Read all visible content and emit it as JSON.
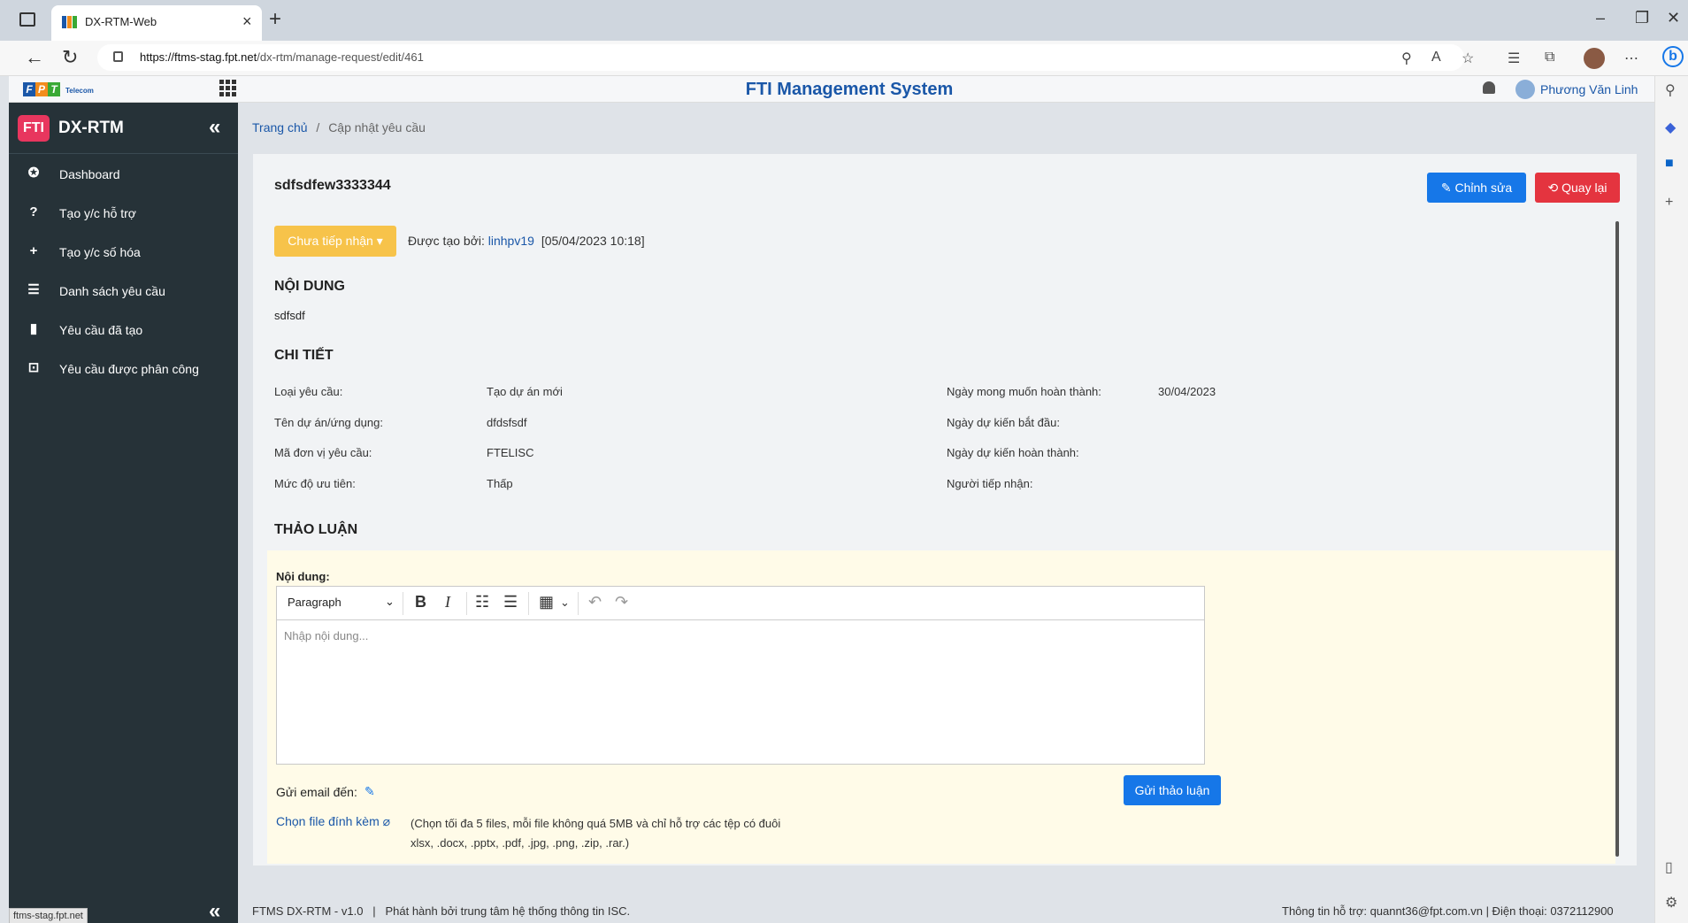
{
  "browser": {
    "tab_title": "DX-RTM-Web",
    "url_host": "https://ftms-stag.fpt.net",
    "url_path": "/dx-rtm/manage-request/edit/461",
    "status_url": "ftms-stag.fpt.net",
    "new_tab": "+",
    "close_tab": "×",
    "win_min": "–",
    "win_restore": "❐",
    "win_close": "✕",
    "back": "←",
    "reload": "↻"
  },
  "header": {
    "logo_letters": [
      "F",
      "P",
      "T"
    ],
    "logo_sub": "Telecom",
    "title": "FTI Management System",
    "user_name": "Phương Văn Linh"
  },
  "sidebar": {
    "badge": "FTI",
    "title": "DX-RTM",
    "collapse": "«",
    "items": [
      {
        "label": "Dashboard",
        "icon": "dashboard-icon",
        "glyph": "✪"
      },
      {
        "label": "Tạo y/c hỗ trợ",
        "icon": "help-circle-icon",
        "glyph": "?"
      },
      {
        "label": "Tạo y/c số hóa",
        "icon": "plus-icon",
        "glyph": "+"
      },
      {
        "label": "Danh sách yêu cầu",
        "icon": "list-icon",
        "glyph": "☰"
      },
      {
        "label": "Yêu cầu đã tạo",
        "icon": "clipboard-icon",
        "glyph": "▮"
      },
      {
        "label": "Yêu cầu được phân công",
        "icon": "assign-icon",
        "glyph": "⊡"
      }
    ]
  },
  "breadcrumb": {
    "home": "Trang chủ",
    "separator": "/",
    "current": "Cập nhật yêu cầu"
  },
  "request": {
    "title": "sdfsdfew3333344",
    "edit_label": "Chỉnh sửa",
    "edit_glyph": "✎",
    "back_label": "Quay lại",
    "back_glyph": "⟲",
    "status": "Chưa tiếp nhận",
    "status_caret": "▾",
    "created_by_label": "Được tạo bởi:",
    "created_by_user": "linhpv19",
    "created_at": "[05/04/2023 10:18]"
  },
  "content": {
    "heading": "NỘI DUNG",
    "text": "sdfsdf"
  },
  "detail": {
    "heading": "CHI TIẾT",
    "left": [
      {
        "label": "Loại yêu cầu:",
        "value": "Tạo dự án mới"
      },
      {
        "label": "Tên dự án/ứng dụng:",
        "value": "dfdsfsdf"
      },
      {
        "label": "Mã đơn vị yêu cầu:",
        "value": "FTELISC"
      },
      {
        "label": "Mức độ ưu tiên:",
        "value": "Thấp"
      }
    ],
    "right": [
      {
        "label": "Ngày mong muốn hoàn thành:",
        "value": "30/04/2023"
      },
      {
        "label": "Ngày dự kiến bắt đầu:",
        "value": ""
      },
      {
        "label": "Ngày dự kiến hoàn thành:",
        "value": ""
      },
      {
        "label": "Người tiếp nhận:",
        "value": ""
      }
    ]
  },
  "discussion": {
    "heading": "THẢO LUẬN",
    "content_label": "Nội dung:",
    "format_select": "Paragraph",
    "placeholder": "Nhập nội dung...",
    "email_label": "Gửi email đến:",
    "send_label": "Gửi thảo luận",
    "attach_label": "Chọn file đính kèm",
    "attach_note": "(Chọn tối đa 5 files, mỗi file không quá 5MB và chỉ hỗ trợ các tệp có đuôi xlsx, .docx, .pptx, .pdf, .jpg, .png, .zip, .rar.)"
  },
  "footer": {
    "left": "FTMS DX-RTM - v1.0   |   Phát hành bởi trung tâm hệ thống thông tin ISC.",
    "right": "Thông tin hỗ trợ: quannt36@fpt.com.vn | Điện thoại: 0372112900"
  },
  "colors": {
    "primary": "#1677e8",
    "danger": "#e4343f",
    "warning": "#f7c34a",
    "sidebar": "#263238",
    "brand_title": "#1a57a8"
  }
}
